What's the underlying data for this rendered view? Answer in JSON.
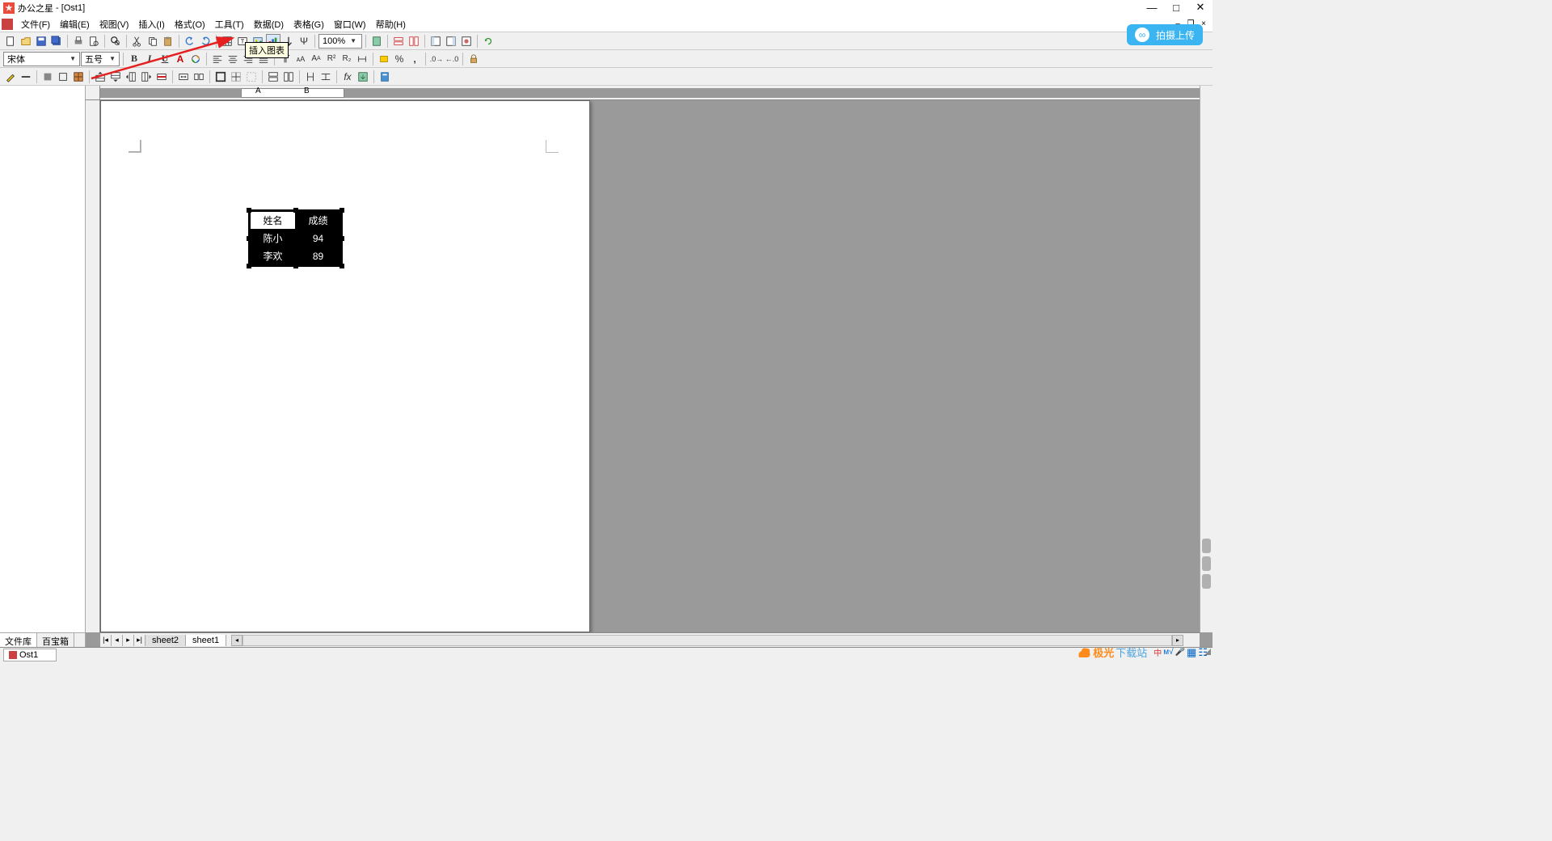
{
  "title": {
    "app": "办公之星",
    "doc": "[Ost1]"
  },
  "menu": {
    "file": "文件(F)",
    "edit": "编辑(E)",
    "view": "视图(V)",
    "insert": "插入(I)",
    "format": "格式(O)",
    "tools": "工具(T)",
    "data": "数据(D)",
    "table": "表格(G)",
    "window": "窗口(W)",
    "help": "帮助(H)"
  },
  "toolbar": {
    "zoom": "100%",
    "tooltip": "插入图表"
  },
  "format": {
    "font": "宋体",
    "size": "五号"
  },
  "cloud": {
    "label": "拍摄上传"
  },
  "ruler": {
    "colA": "A",
    "colB": "B"
  },
  "dtable": {
    "h1": "姓名",
    "h2": "成绩",
    "r1c1": "陈小",
    "r1c2": "94",
    "r2c1": "李欢",
    "r2c2": "89"
  },
  "sheets": {
    "s1": "sheet2",
    "s2": "sheet1"
  },
  "lefttabs": {
    "t1": "文件库",
    "t2": "百宝箱"
  },
  "status": {
    "doc": "Ost1"
  },
  "watermark": {
    "t1": "极光",
    "t2": "下载站"
  },
  "tray": {
    "ime": "中"
  }
}
